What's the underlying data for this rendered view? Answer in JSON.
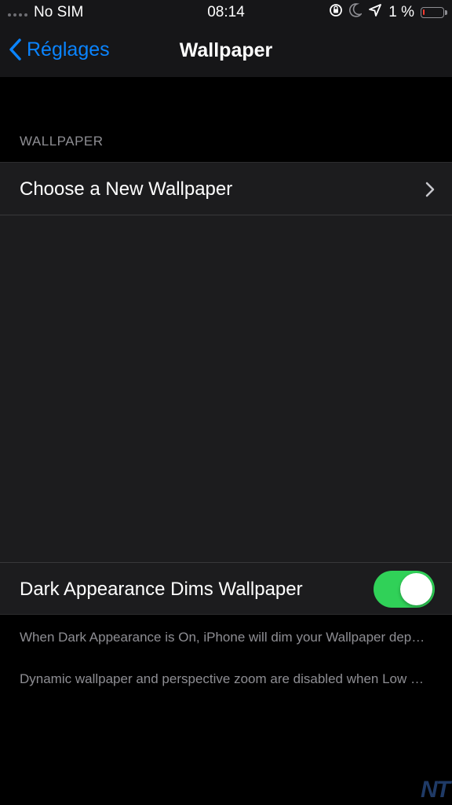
{
  "status_bar": {
    "carrier": "No SIM",
    "time": "08:14",
    "battery_percent": "1 %",
    "battery_level": 0.05,
    "icons": [
      "orientation-lock-icon",
      "moon-icon",
      "location-arrow-icon",
      "battery-icon"
    ]
  },
  "nav": {
    "back_label": "Réglages",
    "title": "Wallpaper"
  },
  "section": {
    "header": "WALLPAPER",
    "choose_label": "Choose a New Wallpaper",
    "dark_label": "Dark Appearance Dims Wallpaper",
    "dark_toggle_on": true
  },
  "notes": {
    "note1": "When Dark Appearance is On, iPhone will dim your Wallpaper depending on ambient light.",
    "note2": "Dynamic wallpaper and perspective zoom are disabled when Low Power Mode is on."
  },
  "watermark": "NT",
  "colors": {
    "accent": "#0a84ff",
    "toggle_on": "#30d158",
    "battery_low": "#ff3b30"
  }
}
